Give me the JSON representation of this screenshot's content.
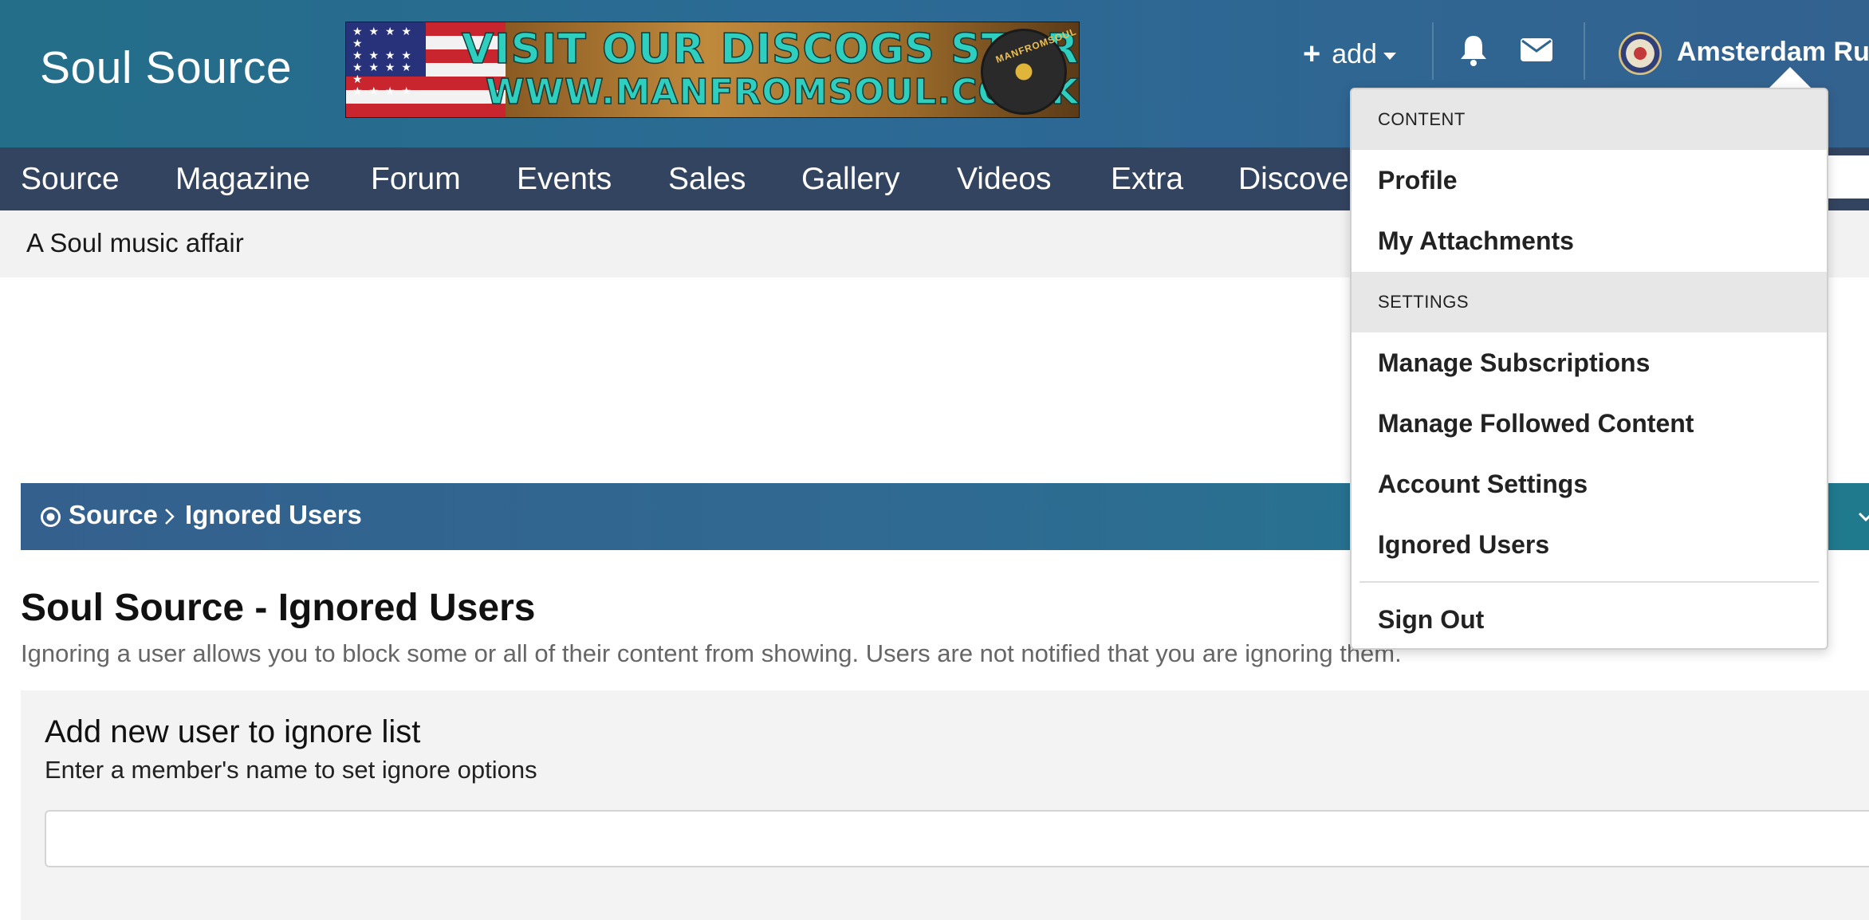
{
  "header": {
    "site_title": "Soul Source",
    "banner": {
      "line1": "VISIT OUR DISCOGS STORE",
      "line2": "WWW.MANFROMSOUL.CO.UK",
      "badge": "MANFROMSOUL"
    },
    "add_label": "add",
    "username": "Amsterdam Rus"
  },
  "nav": {
    "items": [
      {
        "label": "Source"
      },
      {
        "label": "Magazine"
      },
      {
        "label": "Forum"
      },
      {
        "label": "Events"
      },
      {
        "label": "Sales"
      },
      {
        "label": "Gallery"
      },
      {
        "label": "Videos"
      },
      {
        "label": "Extra"
      },
      {
        "label": "Discove"
      }
    ]
  },
  "tagline": "A Soul music affair",
  "breadcrumb": {
    "home": "Source",
    "current": "Ignored Users"
  },
  "page": {
    "title": "Soul Source - Ignored Users",
    "description": "Ignoring a user allows you to block some or all of their content from showing. Users are not notified that you are ignoring them."
  },
  "add_panel": {
    "title": "Add new user to ignore list",
    "subtitle": "Enter a member's name to set ignore options",
    "input_value": ""
  },
  "dropdown": {
    "content_header": "CONTENT",
    "content_items": [
      "Profile",
      "My Attachments"
    ],
    "settings_header": "SETTINGS",
    "settings_items": [
      "Manage Subscriptions",
      "Manage Followed Content",
      "Account Settings",
      "Ignored Users"
    ],
    "sign_out": "Sign Out"
  },
  "icons": {
    "add": "plus-icon",
    "notifications": "bell-icon",
    "messages": "envelope-icon",
    "breadcrumb_home": "home-circle-icon",
    "breadcrumb_separator": "chevron-right-icon"
  }
}
